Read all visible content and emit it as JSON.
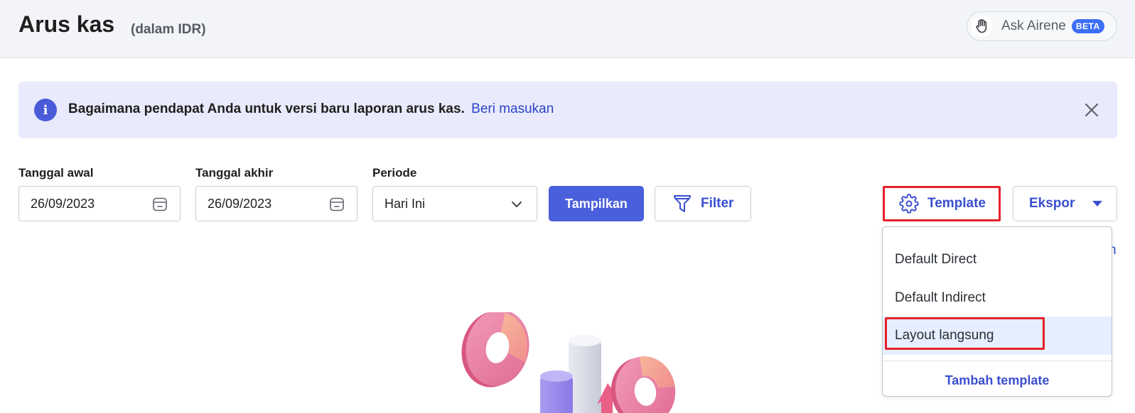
{
  "header": {
    "title": "Arus kas",
    "subtitle": "(dalam IDR)",
    "ask_label": "Ask Airene",
    "beta_badge": "BETA"
  },
  "banner": {
    "text": "Bagaimana pendapat Anda untuk versi baru laporan arus kas.",
    "link": "Beri masukan"
  },
  "filters": {
    "start_label": "Tanggal awal",
    "start_value": "26/09/2023",
    "end_label": "Tanggal akhir",
    "end_value": "26/09/2023",
    "period_label": "Periode",
    "period_value": "Hari Ini",
    "show_button": "Tampilkan",
    "filter_button": "Filter",
    "template_button": "Template",
    "export_button": "Ekspor"
  },
  "template_dropdown": {
    "items": [
      "Default Direct",
      "Default Indirect",
      "Layout langsung"
    ],
    "selected_index": 2,
    "add_label": "Tambah template"
  },
  "peek_text": "n",
  "colors": {
    "primary": "#4a5fdc",
    "link": "#2a44c8",
    "highlight": "#e5202a",
    "banner_bg": "#e9eafb",
    "header_bg": "#f2f4f8"
  }
}
